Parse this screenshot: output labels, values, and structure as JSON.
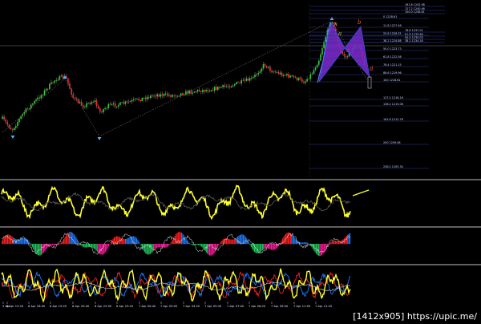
{
  "watermark": "[1412x905] https://upic.me/",
  "colors": {
    "background": "#000000",
    "bull": "#2bd629",
    "bear": "#ff2a2a",
    "stem": "#8a8a8a",
    "zigzag": "#6f7dff",
    "pattern_fill": "#7a28c8",
    "pattern_edge": "#3c5bff",
    "yellow": "#ffff2e",
    "blue": "#1e7bff",
    "red": "#ff2020",
    "green": "#22c55e",
    "magenta": "#ff1aa0",
    "grey_line": "#c8c8c8"
  },
  "pattern_labels": [
    "x",
    "a",
    "b",
    "c",
    "d"
  ],
  "fib_labels": [
    "161.8 1242.98",
    "127.2 1240.46",
    "100.0 1238.61",
    "78.6 1237.01",
    "61.8 1235.88",
    "50.0 1235.03",
    "38.2 1234.18",
    "0 1228.61",
    "11.8 1227.46",
    "23.6 1226.31",
    "38.2 1224.88",
    "50.0 1223.73",
    "61.8 1222.58",
    "76.4 1221.15",
    "88.6 1219.96",
    "100 1218.81",
    "127.2 1216.16",
    "138.2 1215.08",
    "161.8 1212.78",
    "200 1209.06",
    "238.2 1205.34"
  ],
  "time_labels": [
    "5 Apr",
    "6 Apr 15:20",
    "6 Apr 18:00",
    "6 Apr 19:20",
    "6 Apr 20:40",
    "6 Apr 22:00",
    "6 Apr 23:20",
    "7 Apr 00:40",
    "7 Apr 03:00",
    "7 Apr 04:20",
    "7 Apr 05:40",
    "7 Apr 07:00",
    "7 Apr 08:20",
    "7 Apr 09:40",
    "7 Apr 11:00",
    "7 Apr 12:20"
  ],
  "chart_data": {
    "type": "line",
    "panels": [
      "main price chart",
      "oscillator 1",
      "oscillator 2 (histogram)",
      "oscillator 3"
    ],
    "xlabel": "",
    "ylabel": ""
  }
}
